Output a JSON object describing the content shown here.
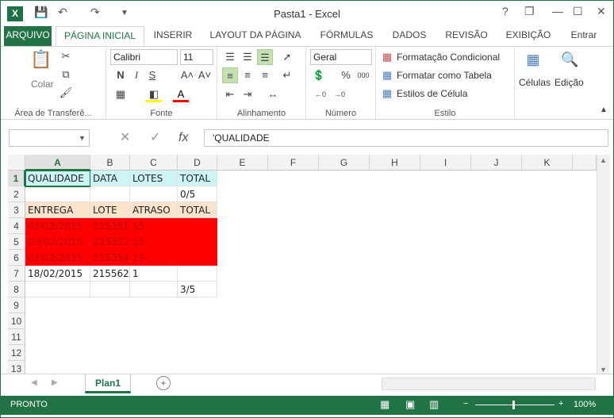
{
  "app": {
    "title": "Pasta1 - Excel",
    "logo": "X"
  },
  "window_controls": {
    "help": "?",
    "restore": "❐",
    "minimize": "—",
    "maximize": "☐",
    "close": "✕"
  },
  "tabs": [
    "ARQUIVO",
    "PÁGINA INICIAL",
    "INSERIR",
    "LAYOUT DA PÁGINA",
    "FÓRMULAS",
    "DADOS",
    "REVISÃO",
    "EXIBIÇÃO",
    "Entrar"
  ],
  "ribbon": {
    "clipboard": {
      "paste": "Colar",
      "label": "Área de Transferê..."
    },
    "font": {
      "name": "Calibri",
      "size": "11",
      "bold": "N",
      "italic": "I",
      "underline": "S",
      "grow": "A˄",
      "shrink": "A˅",
      "label": "Fonte"
    },
    "alignment": {
      "label": "Alinhamento"
    },
    "number": {
      "format": "Geral",
      "percent": "%",
      "thousands": "000",
      "label": "Número"
    },
    "styles": {
      "conditional": "Formatação Condicional",
      "table": "Formatar como Tabela",
      "cell": "Estilos de Célula",
      "label": "Estilo"
    },
    "cells": {
      "label": "Células"
    },
    "editing": {
      "label": "Edição"
    }
  },
  "formula_bar": {
    "name_box": "",
    "fx": "fx",
    "value": "'QUALIDADE"
  },
  "columns": [
    "A",
    "B",
    "C",
    "D",
    "E",
    "F",
    "G",
    "H",
    "I",
    "J",
    "K"
  ],
  "rows": [
    "1",
    "2",
    "3",
    "4",
    "5",
    "6",
    "7",
    "8",
    "9",
    "10",
    "11",
    "12",
    "13"
  ],
  "cells": {
    "r1": [
      "QUALIDADE",
      "DATA",
      "LOTES",
      "TOTAL"
    ],
    "r2": [
      "",
      "",
      "",
      "0/5"
    ],
    "r3": [
      "ENTREGA",
      "LOTE",
      "ATRASO",
      "TOTAL"
    ],
    "r4": [
      "03/02/2015",
      "215351",
      "15",
      ""
    ],
    "r5": [
      "03/02/2015",
      "215352",
      "15",
      ""
    ],
    "r6": [
      "03/02/2015",
      "215354",
      "19",
      ""
    ],
    "r7": [
      "18/02/2015",
      "215562",
      "1",
      ""
    ],
    "r8": [
      "",
      "",
      "",
      "3/5"
    ]
  },
  "sheets": [
    "Plan1"
  ],
  "status": {
    "ready": "PRONTO",
    "zoom": "100%"
  },
  "colors": {
    "accent": "#217346",
    "cyan": "#ccf5f5",
    "peach": "#fbe3cc",
    "red": "#ff0000"
  }
}
